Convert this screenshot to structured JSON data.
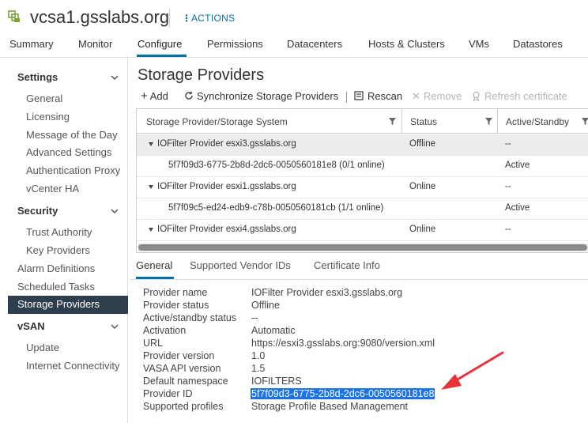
{
  "header": {
    "title": "vcsa1.gsslabs.org",
    "actions_label": "ACTIONS"
  },
  "tabs": [
    "Summary",
    "Monitor",
    "Configure",
    "Permissions",
    "Datacenters",
    "Hosts & Clusters",
    "VMs",
    "Datastores"
  ],
  "active_tab": "Configure",
  "sidebar": {
    "settings": {
      "label": "Settings",
      "items": [
        "General",
        "Licensing",
        "Message of the Day",
        "Advanced Settings",
        "Authentication Proxy",
        "vCenter HA"
      ]
    },
    "security": {
      "label": "Security",
      "items": [
        "Trust Authority",
        "Key Providers"
      ]
    },
    "misc": [
      "Alarm Definitions",
      "Scheduled Tasks",
      "Storage Providers"
    ],
    "vsan": {
      "label": "vSAN",
      "items": [
        "Update",
        "Internet Connectivity"
      ]
    }
  },
  "main": {
    "title": "Storage Providers",
    "toolbar": {
      "add": "Add",
      "sync": "Synchronize Storage Providers",
      "rescan": "Rescan",
      "remove": "Remove",
      "refresh": "Refresh certificate"
    },
    "grid": {
      "columns": [
        "Storage Provider/Storage System",
        "Status",
        "Active/Standby"
      ],
      "rows": [
        {
          "name": "IOFilter Provider esxi3.gsslabs.org",
          "status": "Offline",
          "standby": "--"
        },
        {
          "name": "5f7f09d3-6775-2b8d-2dc6-0050560181e8 (0/1 online)",
          "status": "",
          "standby": "Active"
        },
        {
          "name": "IOFilter Provider esxi1.gsslabs.org",
          "status": "Online",
          "standby": "--"
        },
        {
          "name": "5f7f09c5-ed24-edb9-c78b-0050560181cb (1/1 online)",
          "status": "",
          "standby": "Active"
        },
        {
          "name": "IOFilter Provider esxi4.gsslabs.org",
          "status": "Online",
          "standby": "--"
        }
      ]
    },
    "detail_tabs": [
      "General",
      "Supported Vendor IDs",
      "Certificate Info"
    ],
    "details": [
      {
        "label": "Provider name",
        "value": "IOFilter Provider esxi3.gsslabs.org"
      },
      {
        "label": "Provider status",
        "value": "Offline"
      },
      {
        "label": "Active/standby status",
        "value": "--"
      },
      {
        "label": "Activation",
        "value": "Automatic"
      },
      {
        "label": "URL",
        "value": "https://esxi3.gsslabs.org:9080/version.xml"
      },
      {
        "label": "Provider version",
        "value": "1.0"
      },
      {
        "label": "VASA API version",
        "value": "1.5"
      },
      {
        "label": "Default namespace",
        "value": "IOFILTERS"
      },
      {
        "label": "Provider ID",
        "value": "5f7f09d3-6775-2b8d-2dc6-0050560181e8"
      },
      {
        "label": "Supported profiles",
        "value": "Storage Profile Based Management"
      }
    ]
  },
  "colors": {
    "accent": "#0072a3",
    "sidebar_active": "#2e3e4d",
    "highlight": "#1a73e8",
    "arrow": "#e8323c"
  }
}
